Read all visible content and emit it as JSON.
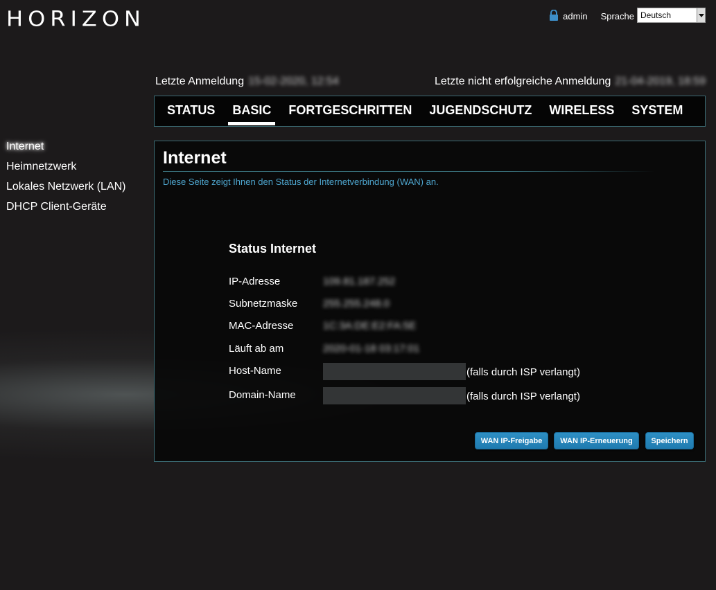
{
  "brand": {
    "logo_text": "HORIZON"
  },
  "topbar": {
    "user": "admin",
    "language_label": "Sprache",
    "language_selected": "Deutsch"
  },
  "login_info": {
    "last_login_label": "Letzte Anmeldung",
    "last_login_value": "15-02-2020, 12:54",
    "last_failed_label": "Letzte nicht erfolgreiche Anmeldung",
    "last_failed_value": "21-04-2019, 18:59"
  },
  "nav": {
    "tabs": [
      {
        "label": "STATUS"
      },
      {
        "label": "BASIC",
        "active": true
      },
      {
        "label": "FORTGESCHRITTEN"
      },
      {
        "label": "JUGENDSCHUTZ"
      },
      {
        "label": "WIRELESS"
      },
      {
        "label": "SYSTEM"
      }
    ]
  },
  "sidebar": {
    "items": [
      {
        "label": "Internet",
        "active": true
      },
      {
        "label": "Heimnetzwerk"
      },
      {
        "label": "Lokales Netzwerk (LAN)"
      },
      {
        "label": "DHCP Client-Geräte"
      }
    ]
  },
  "main": {
    "title": "Internet",
    "description": "Diese Seite zeigt Ihnen den Status der Internetverbindung (WAN) an.",
    "status_title": "Status Internet",
    "rows": [
      {
        "label": "IP-Adresse",
        "value": "109.81.187.252"
      },
      {
        "label": "Subnetzmaske",
        "value": "255.255.248.0"
      },
      {
        "label": "MAC-Adresse",
        "value": "1C:3A:DE:E2:FA:5E"
      },
      {
        "label": "Läuft ab am",
        "value": "2020-01-18 03:17:01"
      }
    ],
    "host_name_label": "Host-Name",
    "host_name_value": "",
    "domain_name_label": "Domain-Name",
    "domain_name_value": "",
    "isp_hint": "(falls durch ISP verlangt)",
    "buttons": {
      "wan_release": "WAN IP-Freigabe",
      "wan_renew": "WAN IP-Erneuerung",
      "save": "Speichern"
    }
  },
  "colors": {
    "accent_link": "#4ea6cf",
    "border": "#3b6c75",
    "button": "#2386bb",
    "background": "#1c1a1b"
  }
}
